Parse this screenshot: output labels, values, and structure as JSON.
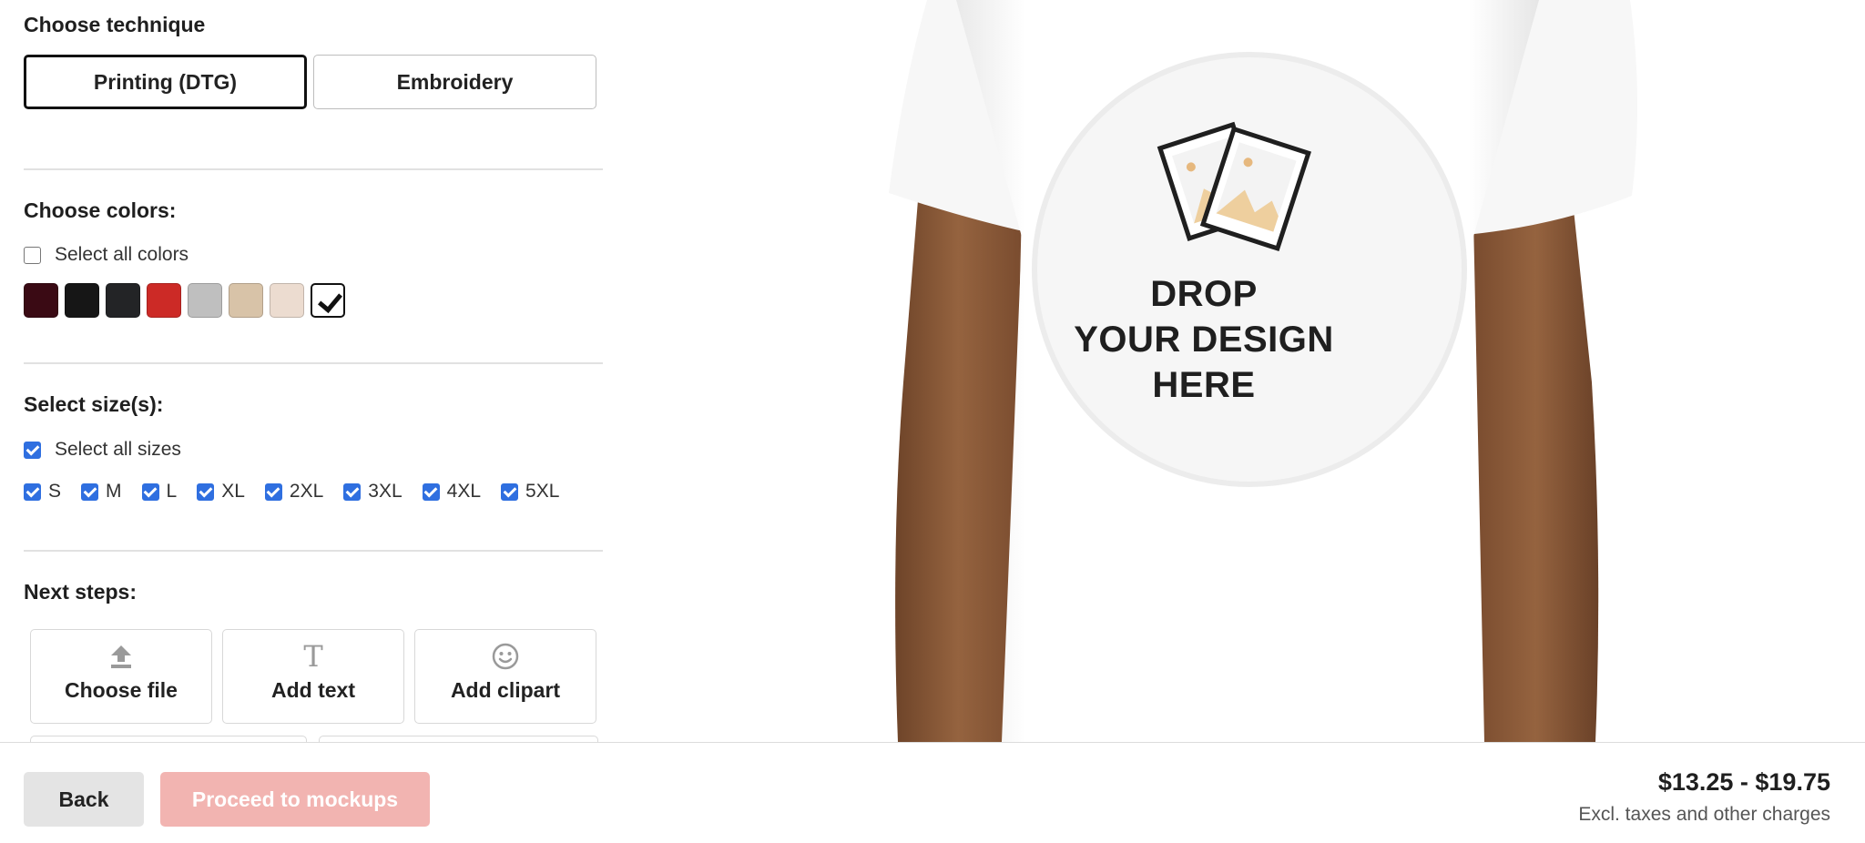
{
  "technique": {
    "heading": "Choose technique",
    "options": [
      {
        "label": "Printing (DTG)",
        "selected": true
      },
      {
        "label": "Embroidery",
        "selected": false
      }
    ]
  },
  "colors": {
    "heading": "Choose colors:",
    "select_all_label": "Select all colors",
    "select_all_checked": false,
    "swatches": [
      {
        "hex": "#3a0a14",
        "selected": false
      },
      {
        "hex": "#161616",
        "selected": false
      },
      {
        "hex": "#232426",
        "selected": false
      },
      {
        "hex": "#cc2a26",
        "selected": false
      },
      {
        "hex": "#bfbfbf",
        "selected": false
      },
      {
        "hex": "#d8c3a8",
        "selected": false
      },
      {
        "hex": "#ecdcd0",
        "selected": false
      },
      {
        "hex": "#ffffff",
        "selected": true
      }
    ]
  },
  "sizes": {
    "heading": "Select size(s):",
    "select_all_label": "Select all sizes",
    "select_all_checked": true,
    "items": [
      {
        "label": "S",
        "checked": true
      },
      {
        "label": "M",
        "checked": true
      },
      {
        "label": "L",
        "checked": true
      },
      {
        "label": "XL",
        "checked": true
      },
      {
        "label": "2XL",
        "checked": true
      },
      {
        "label": "3XL",
        "checked": true
      },
      {
        "label": "4XL",
        "checked": true
      },
      {
        "label": "5XL",
        "checked": true
      }
    ]
  },
  "next_steps": {
    "heading": "Next steps:",
    "choose_file": "Choose file",
    "add_text": "Add text",
    "add_clipart": "Add clipart",
    "add_text_icon": "T"
  },
  "preview": {
    "drop_line1": "DROP",
    "drop_line2": "YOUR DESIGN",
    "drop_line3": "HERE"
  },
  "footer": {
    "back_label": "Back",
    "proceed_label": "Proceed to mockups",
    "price": "$13.25 - $19.75",
    "price_note": "Excl. taxes and other charges"
  },
  "colors_theme": {
    "checkbox": "#2f6fe0",
    "proceed_disabled": "#f2b4b1",
    "skin": "#8a5a3c",
    "tee": "#ffffff"
  }
}
